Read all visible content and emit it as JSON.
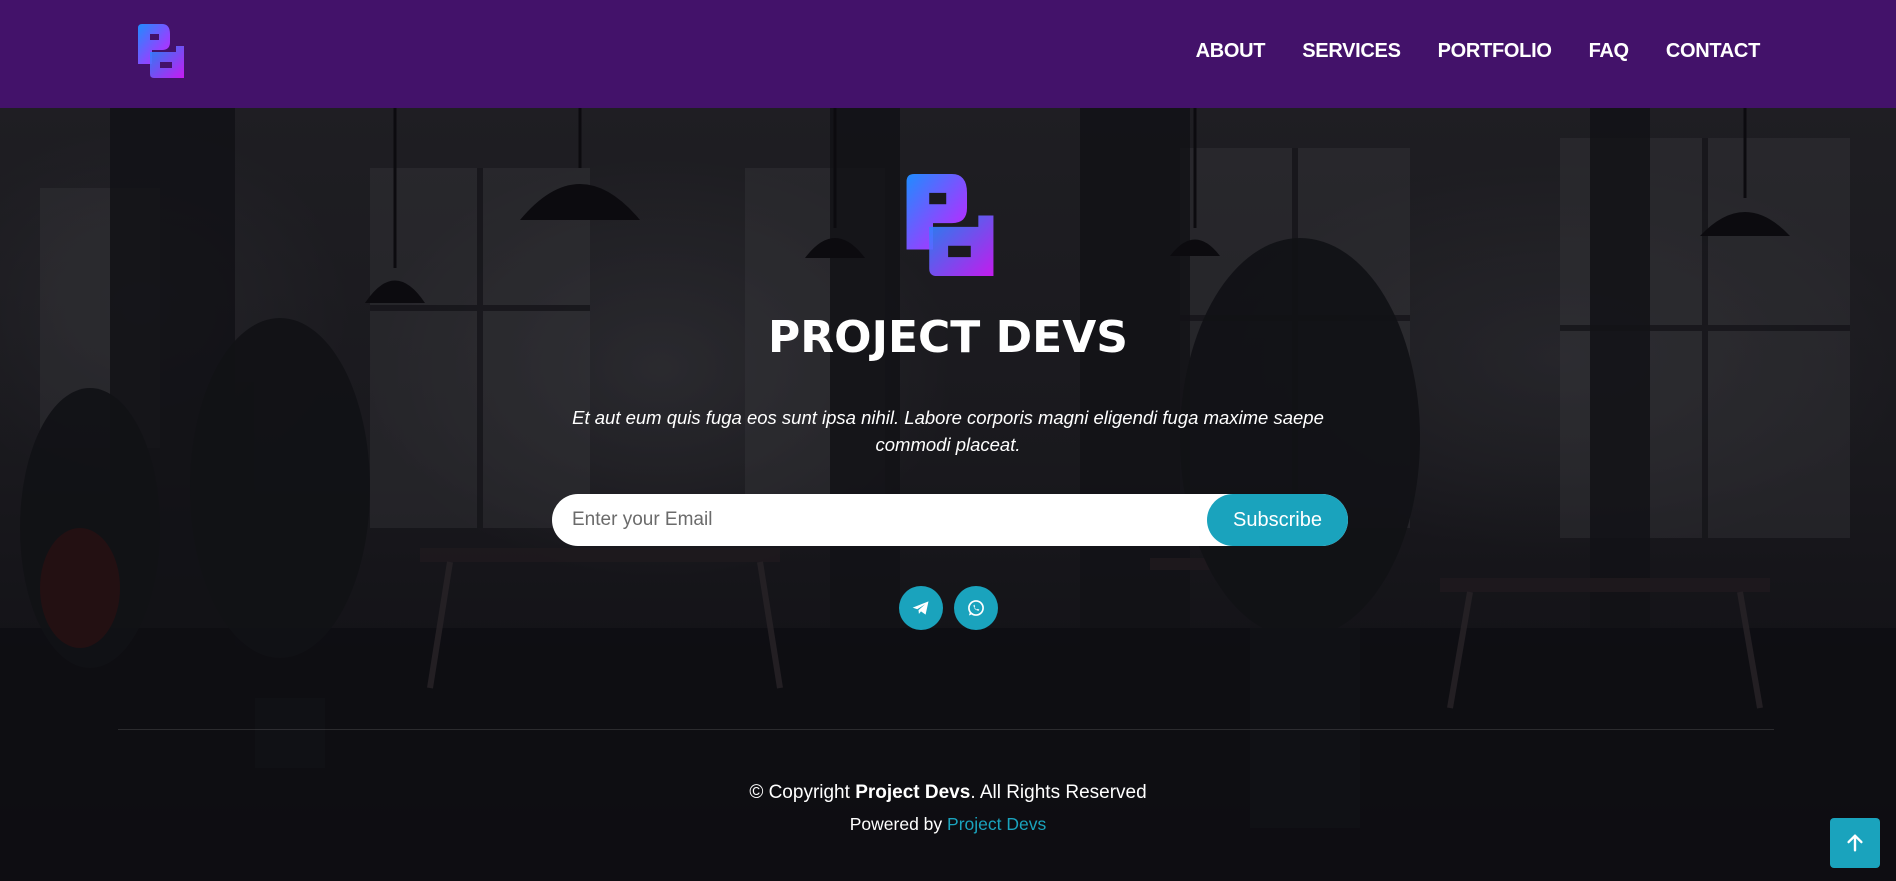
{
  "header": {
    "nav": [
      {
        "label": "ABOUT"
      },
      {
        "label": "SERVICES"
      },
      {
        "label": "PORTFOLIO"
      },
      {
        "label": "FAQ"
      },
      {
        "label": "CONTACT"
      }
    ]
  },
  "footer": {
    "brand_title": "PROJECT DEVS",
    "tagline": "Et aut eum quis fuga eos sunt ipsa nihil. Labore corporis magni eligendi fuga maxime saepe commodi placeat.",
    "subscribe": {
      "placeholder": "Enter your Email",
      "button_label": "Subscribe"
    },
    "socials": [
      {
        "icon": "telegram-icon"
      },
      {
        "icon": "whatsapp-icon"
      }
    ],
    "copyright_prefix": "© Copyright ",
    "copyright_brand": "Project Devs",
    "copyright_suffix": ". All Rights Reserved",
    "powered_prefix": "Powered by ",
    "powered_link": "Project Devs"
  },
  "colors": {
    "header_bg": "#43126a",
    "accent": "#1aa3bd",
    "logo_gradient_start": "#1f8cff",
    "logo_gradient_end": "#d21bff"
  },
  "icons": {
    "back_to_top": "arrow-up-icon"
  }
}
